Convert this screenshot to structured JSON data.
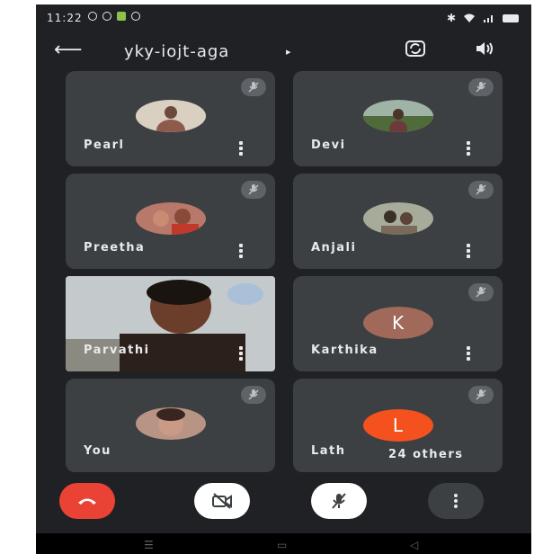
{
  "status_bar": {
    "time": "11:22"
  },
  "header": {
    "meeting_code": "yky-iojt-aga",
    "caret": "▸"
  },
  "participants": [
    {
      "name": "Pearl",
      "avatar_color": "#c9b59a"
    },
    {
      "name": "Devi",
      "avatar_color": "#6d8b5a"
    },
    {
      "name": "Preetha",
      "avatar_color": "#b25a4a"
    },
    {
      "name": "Anjali",
      "avatar_color": "#8a8f7a"
    },
    {
      "name": "Parvathi"
    },
    {
      "name": "Karthika",
      "initial": "K",
      "avatar_color": "#a1695a"
    },
    {
      "name": "You",
      "avatar_color": "#9a7a6a"
    },
    {
      "name": "Lath",
      "initial": "L",
      "avatar_color": "#f4511e",
      "others_label": "24 others"
    }
  ],
  "controls": {
    "end_call_color": "#ea4335",
    "camera_state": "off",
    "mic_state": "muted"
  },
  "colors": {
    "background": "#202124",
    "tile": "#3c4043",
    "text": "#e8eaed"
  }
}
